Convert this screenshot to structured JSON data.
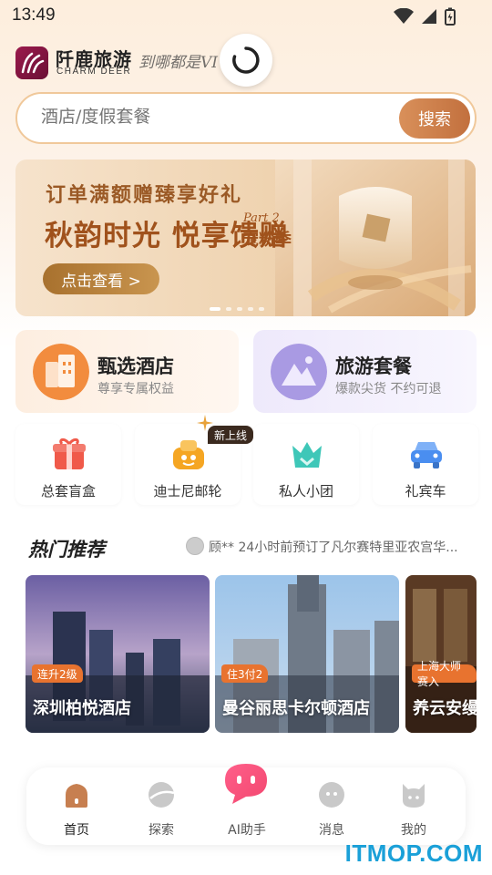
{
  "status_bar": {
    "time": "13:49"
  },
  "header": {
    "brand_cn": "阡鹿旅游",
    "brand_en": "CHARM DEER",
    "slogan": "到哪都是VI"
  },
  "search": {
    "placeholder": "酒店/度假套餐",
    "button_label": "搜索"
  },
  "banner": {
    "title1": "订单满额赠臻享好礼",
    "title2": "秋韵时光 悦享馈赠",
    "part": "Part 2",
    "subtitle": "宠粉季",
    "button_label": "点击查看 >"
  },
  "features": [
    {
      "title": "甄选酒店",
      "subtitle": "尊享专属权益",
      "color": "#f08a3c"
    },
    {
      "title": "旅游套餐",
      "subtitle": "爆款尖货 不约可退",
      "color": "#a394e0"
    }
  ],
  "mini_items": [
    {
      "label": "总套盲盒",
      "icon": "gift-icon",
      "color": "#f05a4a"
    },
    {
      "label": "迪士尼邮轮",
      "icon": "ship-icon",
      "color": "#f5a623"
    },
    {
      "label": "私人小团",
      "icon": "crown-icon",
      "color": "#3ec7b8"
    },
    {
      "label": "礼宾车",
      "icon": "car-icon",
      "color": "#4a8ef0"
    }
  ],
  "new_tag": "新上线",
  "hot": {
    "title": "热门推荐",
    "ticker": "顾** 24小时前预订了凡尔赛特里亚农宫华...",
    "cards": [
      {
        "name": "深圳柏悦酒店",
        "tag": "连升2级"
      },
      {
        "name": "曼谷丽思卡尔顿酒店",
        "tag": "住3付2"
      },
      {
        "name": "养云安缦",
        "tag": "上海大师赛入"
      }
    ]
  },
  "nav": {
    "items": [
      {
        "label": "首页",
        "icon": "home-icon"
      },
      {
        "label": "探索",
        "icon": "planet-icon"
      },
      {
        "label": "AI助手",
        "icon": "ai-assistant-icon"
      },
      {
        "label": "消息",
        "icon": "message-icon"
      },
      {
        "label": "我的",
        "icon": "profile-icon"
      }
    ]
  },
  "watermark": "ITMOP.COM"
}
